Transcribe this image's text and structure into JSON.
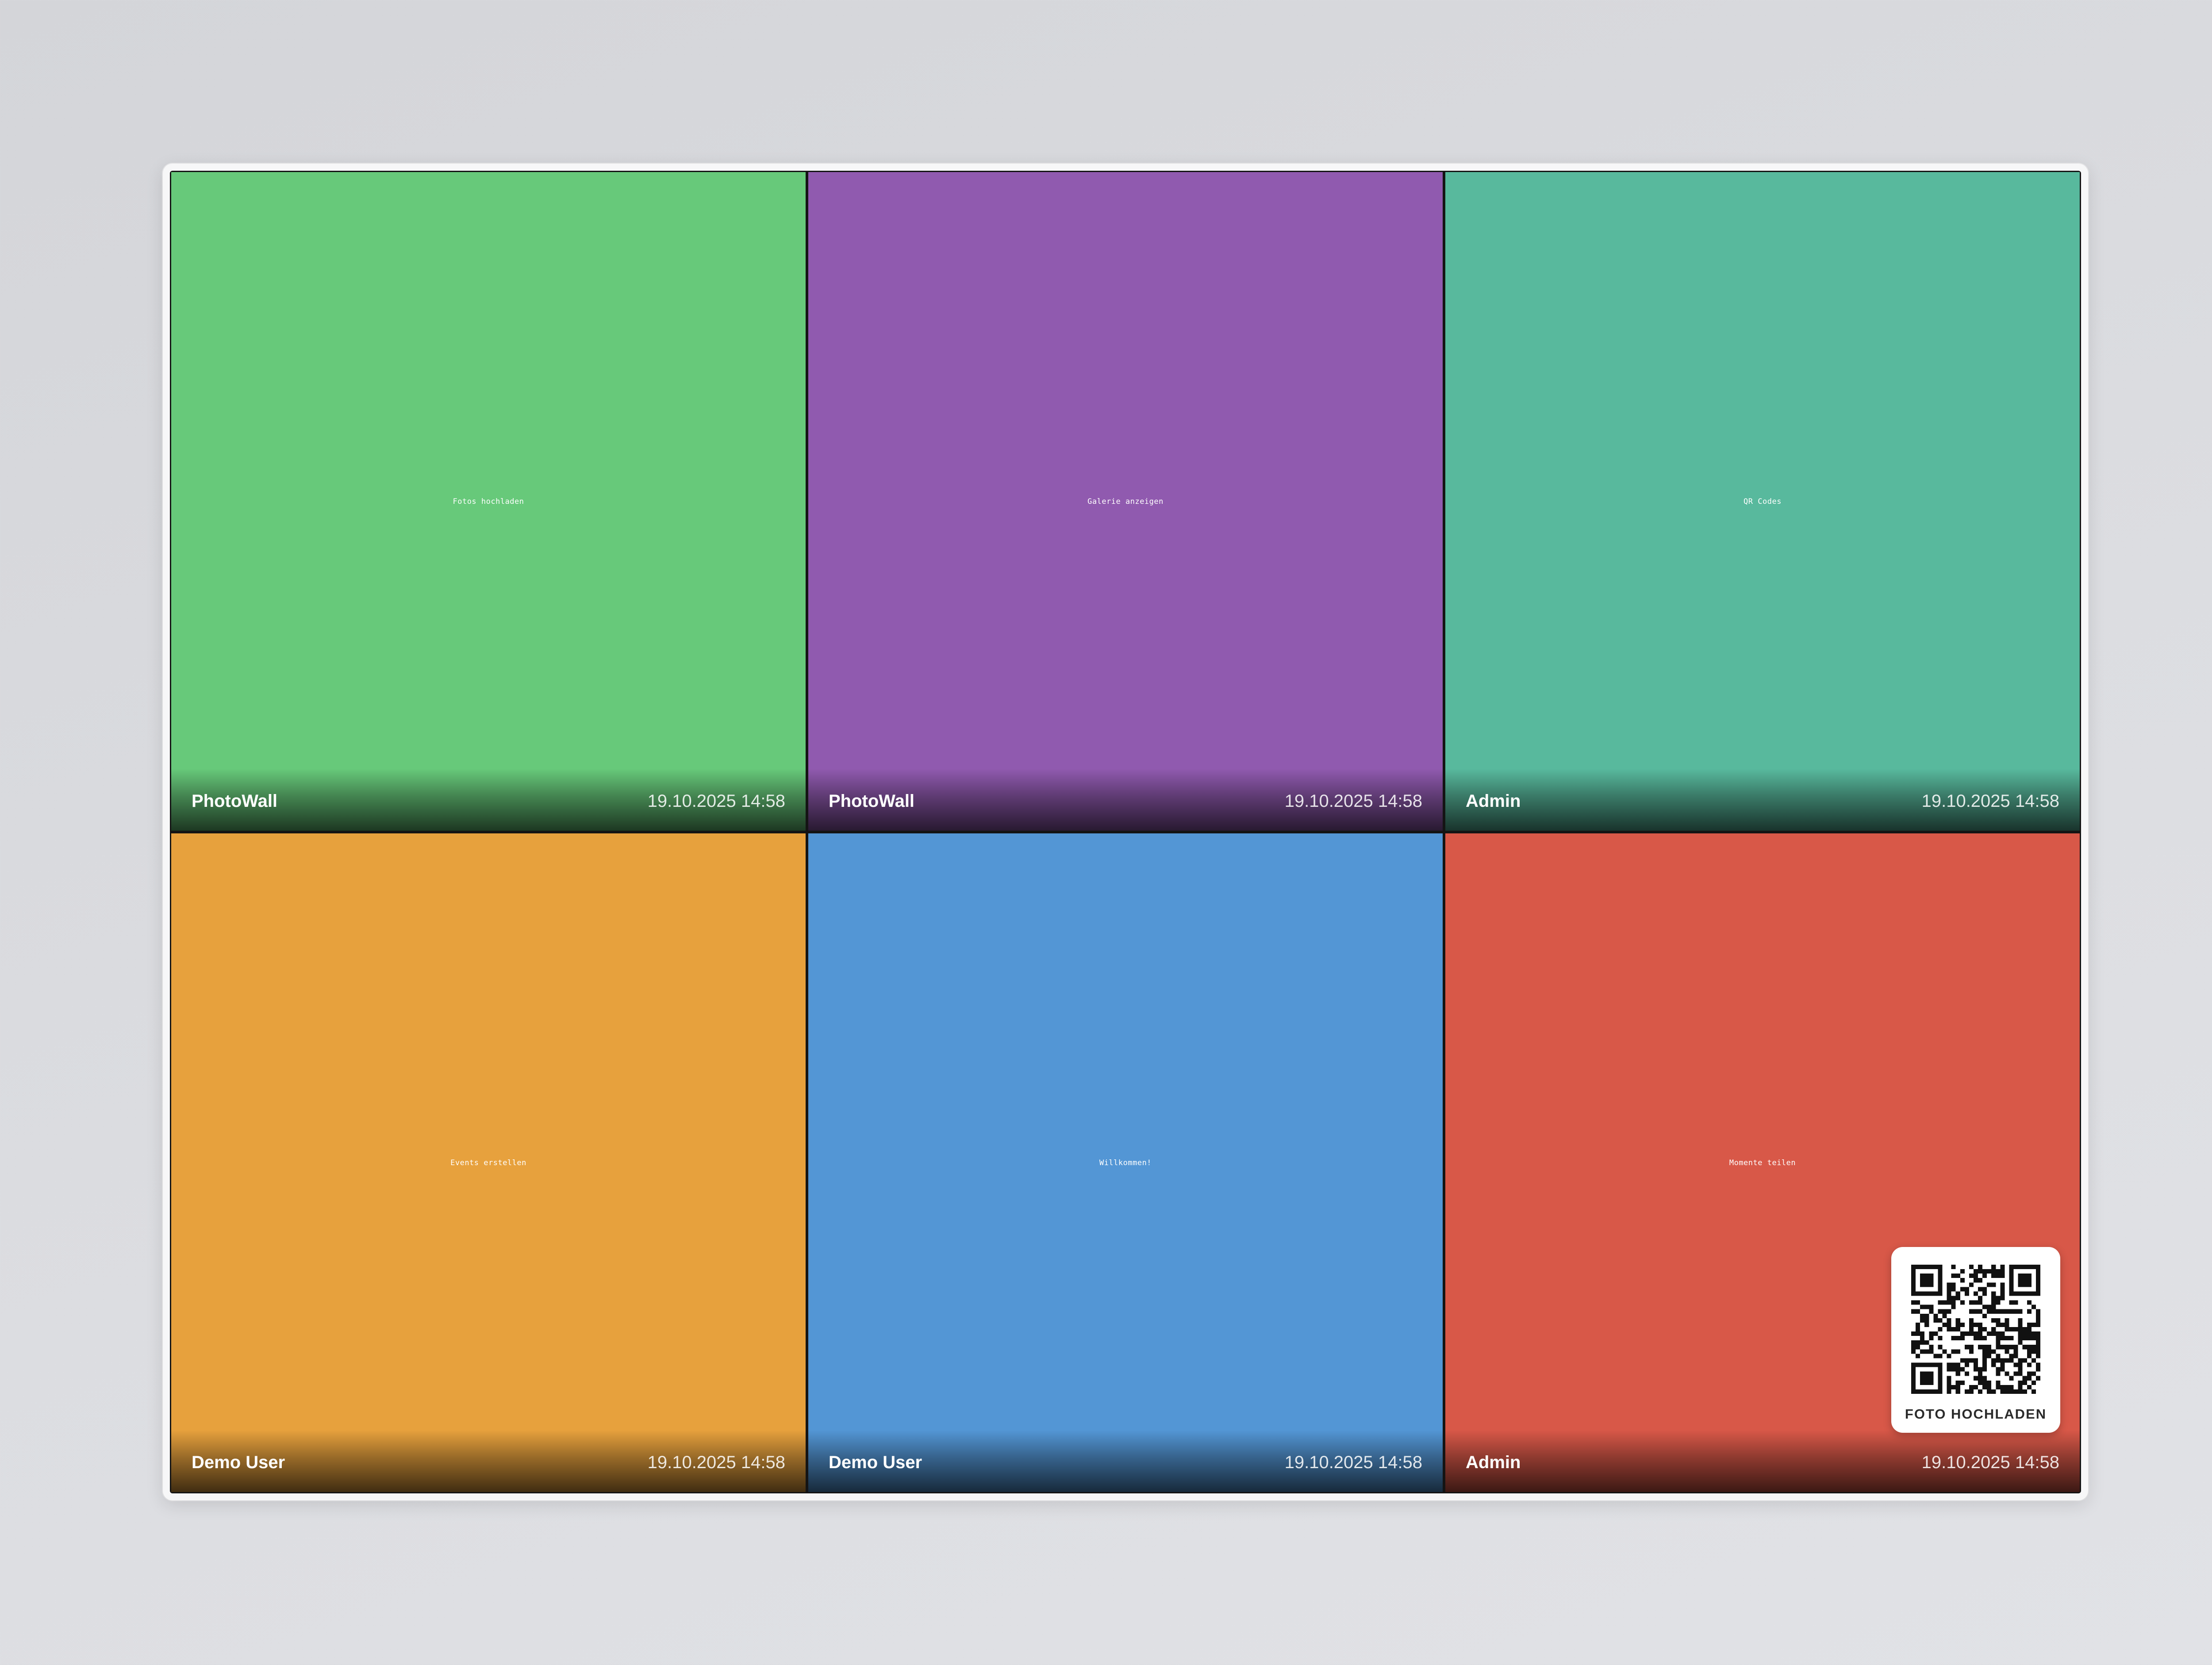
{
  "tiles": [
    {
      "caption": "Fotos hochladen",
      "author": "PhotoWall",
      "time": "19.10.2025 14:58",
      "color": "#67c97a"
    },
    {
      "caption": "Galerie anzeigen",
      "author": "PhotoWall",
      "time": "19.10.2025 14:58",
      "color": "#905aaf"
    },
    {
      "caption": "QR Codes",
      "author": "Admin",
      "time": "19.10.2025 14:58",
      "color": "#58b99d"
    },
    {
      "caption": "Events erstellen",
      "author": "Demo User",
      "time": "19.10.2025 14:58",
      "color": "#e7a13d"
    },
    {
      "caption": "Willkommen!",
      "author": "Demo User",
      "time": "19.10.2025 14:58",
      "color": "#5396d5"
    },
    {
      "caption": "Momente teilen",
      "author": "Admin",
      "time": "19.10.2025 14:58",
      "color": "#d85848"
    }
  ],
  "qr_widget": {
    "label": "FOTO HOCHLADEN",
    "icon": "qr-code-icon"
  }
}
